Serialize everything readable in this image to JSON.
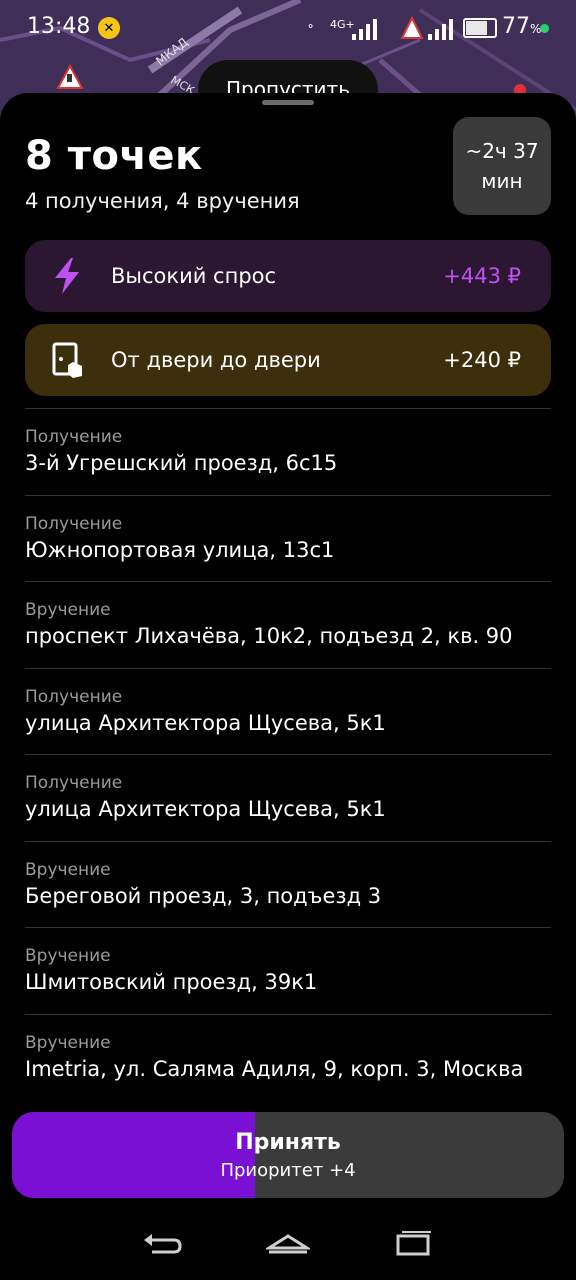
{
  "status_bar": {
    "time": "13:48",
    "network": "4G+",
    "battery_text": "77",
    "battery_unit": "%",
    "battery_level": 0.77
  },
  "map": {
    "labels": [
      "МКАД",
      "МСК"
    ]
  },
  "skip_button": "Пропустить",
  "order": {
    "title": "8 точек",
    "subtitle": "4 получения, 4 вручения",
    "eta_line1": "~2ч 37",
    "eta_line2": "мин"
  },
  "promos": [
    {
      "label": "Высокий спрос",
      "amount": "+443 ₽",
      "icon": "lightning-icon",
      "color": "#c051f0"
    },
    {
      "label": "От двери до двери",
      "amount": "+240 ₽",
      "icon": "door-box-icon",
      "color": "#ffffff"
    }
  ],
  "stops": [
    {
      "type": "Получение",
      "address": "3-й Угрешский проезд, 6с15"
    },
    {
      "type": "Получение",
      "address": "Южнопортовая улица, 13с1"
    },
    {
      "type": "Вручение",
      "address": "проспект Лихачёва, 10к2, подъезд 2, кв. 90"
    },
    {
      "type": "Получение",
      "address": "улица Архитектора Щусева, 5к1"
    },
    {
      "type": "Получение",
      "address": "улица Архитектора Щусева, 5к1"
    },
    {
      "type": "Вручение",
      "address": "Береговой проезд, 3, подъезд 3"
    },
    {
      "type": "Вручение",
      "address": "Шмитовский проезд, 39к1"
    },
    {
      "type": "Вручение",
      "address": "Imetria, ул. Саляма Адиля, 9, корп. 3, Москва"
    }
  ],
  "accept_button": {
    "label": "Принять",
    "sublabel": "Приоритет +4",
    "progress": 0.44
  },
  "colors": {
    "accent": "#7a10d4",
    "high_demand": "#c051f0"
  }
}
